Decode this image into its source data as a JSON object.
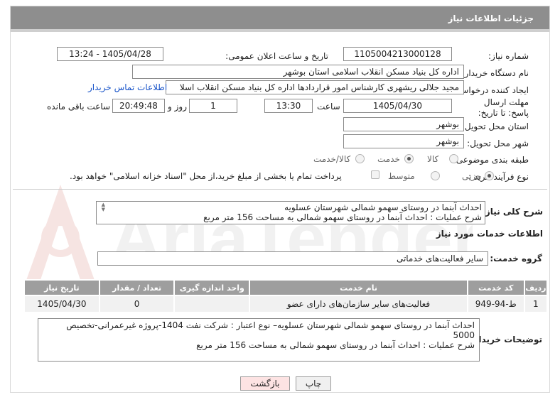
{
  "header": {
    "title": "جزئیات اطلاعات نیاز"
  },
  "form": {
    "need_number": {
      "label": "شماره نیاز:",
      "value": "1105004213000128"
    },
    "announce_datetime": {
      "label": "تاریخ و ساعت اعلان عمومی:",
      "value": "1405/04/28 - 13:24"
    },
    "buyer_org": {
      "label": "نام دستگاه خریدار:",
      "value": "اداره کل بنیاد مسکن انقلاب اسلامی استان بوشهر"
    },
    "requester": {
      "label": "ایجاد کننده درخواست:",
      "value": "مجید جلالی ریشهری کارشناس امور قراردادها اداره کل بنیاد مسکن انقلاب اسلا",
      "contact_link": "اطلاعات تماس خریدار"
    },
    "deadline": {
      "label": "مهلت ارسال پاسخ: تا تاریخ:",
      "date": "1405/04/30",
      "time_label": "ساعت",
      "time": "13:30",
      "days": "1",
      "days_label": "روز و",
      "remaining": "20:49:48",
      "remaining_label": "ساعت باقی مانده"
    },
    "province": {
      "label": "استان محل تحویل:",
      "value": "بوشهر"
    },
    "city": {
      "label": "شهر محل تحویل:",
      "value": "بوشهر"
    },
    "category": {
      "label": "طبقه بندی موضوعی:",
      "options": [
        "کالا",
        "خدمت",
        "کالا/خدمت"
      ],
      "selected": "خدمت"
    },
    "purchase_type": {
      "label": "نوع فرآیند خرید :",
      "options": [
        "جزیی",
        "متوسط"
      ],
      "selected": "جزیی",
      "treasury_note": "پرداخت تمام یا بخشی از مبلغ خرید،از محل \"اسناد خزانه اسلامی\" خواهد بود."
    }
  },
  "summary": {
    "label": "شرح کلی نیاز:",
    "line1": "احداث آبنما در روستای سهمو شمالی شهرستان عسلویه",
    "line2": "شرح عملیات : احداث آبنما در روستای سهمو شمالی به مساحت 156 متر مربع"
  },
  "services_section": {
    "title": "اطلاعات خدمات مورد نیاز"
  },
  "service_group": {
    "label": "گروه خدمت:",
    "value": "سایر فعالیت‌های خدماتی"
  },
  "table": {
    "headers": [
      "ردیف",
      "کد خدمت",
      "نام خدمت",
      "واحد اندازه گیری",
      "تعداد / مقدار",
      "تاریخ نیاز"
    ],
    "rows": [
      [
        "1",
        "ط-94-949",
        "فعالیت‌های سایر سازمان‌های دارای عضو",
        "",
        "0",
        "1405/04/30"
      ]
    ]
  },
  "buyer_notes": {
    "label": "توضیحات خریدار:",
    "line1": "احداث آبنما در روستای سهمو شمالی شهرستان عسلویه– نوع اعتبار : شرکت نفت 1404-پروژه غیرعمرانی-تخصیص 5000",
    "line2": "شرح عملیات : احداث آبنما در روستای سهمو شمالی به مساحت 156 متر مربع"
  },
  "buttons": {
    "print": "چاپ",
    "back": "بازگشت"
  },
  "watermark": {
    "text": "AriaTender.neT"
  }
}
